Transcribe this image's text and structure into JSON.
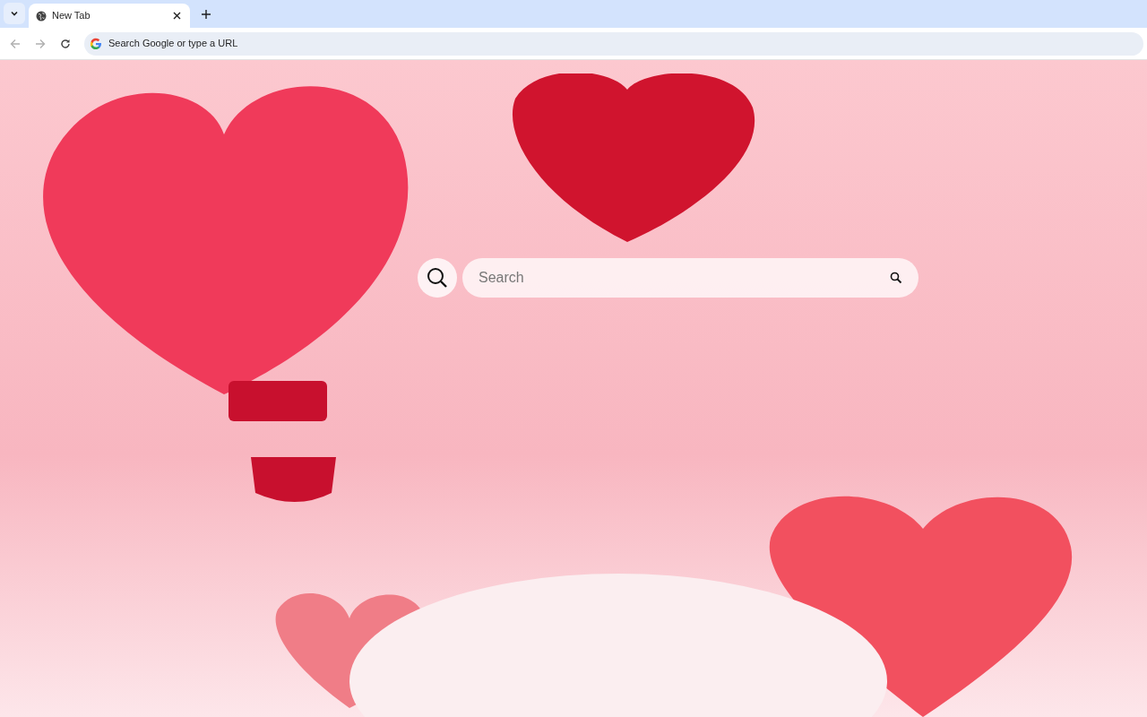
{
  "tabs": [
    {
      "title": "New Tab",
      "selected": true
    }
  ],
  "address_bar": {
    "placeholder": "Search Google or type a URL"
  },
  "search": {
    "placeholder": "Search"
  }
}
